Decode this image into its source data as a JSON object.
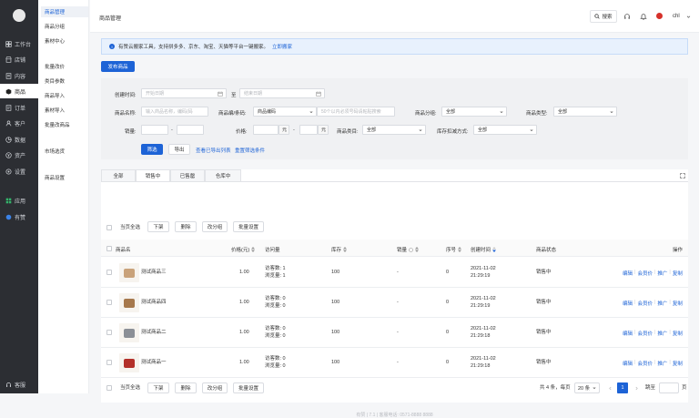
{
  "left_nav": {
    "items": [
      {
        "label": "工作台",
        "icon": "dashboard-icon"
      },
      {
        "label": "店铺",
        "icon": "store-icon"
      },
      {
        "label": "内容",
        "icon": "content-icon"
      },
      {
        "label": "商品",
        "icon": "goods-icon"
      },
      {
        "label": "订单",
        "icon": "order-icon"
      },
      {
        "label": "客户",
        "icon": "customer-icon"
      },
      {
        "label": "数据",
        "icon": "data-icon"
      },
      {
        "label": "资产",
        "icon": "asset-icon"
      },
      {
        "label": "设置",
        "icon": "settings-icon"
      },
      {
        "label": "应用",
        "icon": "apps-icon"
      },
      {
        "label": "有赞",
        "icon": "youzan-icon"
      }
    ],
    "service": "客服"
  },
  "sub_nav": {
    "items": [
      "商品管理",
      "商品分组",
      "素材中心",
      "批量改价",
      "类目参数",
      "商品导入",
      "素材导入",
      "批量改商品",
      "市场选货",
      "商品设置"
    ]
  },
  "topbar": {
    "title": "商品管理",
    "search": "搜索",
    "user": "chl"
  },
  "notice": {
    "text": "有赞云搬家工具，支持拼多多、京东、淘宝、天猫等平台一键搬家。",
    "link": "立即搬家"
  },
  "publish_button": "发布商品",
  "filter": {
    "created_label": "创建时间:",
    "start_placeholder": "开始日期",
    "to": "至",
    "end_placeholder": "结束日期",
    "name_label": "商品名称:",
    "name_placeholder": "输入商品名称，编码(码",
    "code_label": "商品编/条码:",
    "code_value": "商品编码",
    "code_placeholder": "50个以内必须号码请粘贴搜索",
    "group_label": "商品分组:",
    "group_value": "全部",
    "type_label": "商品类型:",
    "type_value": "全部",
    "sales_label": "销量:",
    "dash": "-",
    "price_label": "价格:",
    "yuan": "元",
    "category_label": "商品类目:",
    "category_value": "全部",
    "stock_label": "库存扣减方式:",
    "stock_value": "全部",
    "filter_btn": "筛选",
    "export_btn": "导出",
    "view_exported": "查看已导出列表",
    "reset": "重置筛选条件"
  },
  "tabs": [
    "全部",
    "销售中",
    "已售罄",
    "仓库中"
  ],
  "bulk": {
    "select_all": "当页全选",
    "off_shelf": "下架",
    "delete": "删除",
    "change_group": "改分组",
    "batch_settings": "批量设置"
  },
  "table": {
    "headers": [
      "商品名",
      "价格(元)",
      "访问量",
      "库存",
      "销量",
      "序号",
      "创建时间",
      "商品状态",
      "操作"
    ],
    "rows": [
      {
        "name": "测试商品三",
        "price": "1.00",
        "visitors": "访客数: 1",
        "views": "浏览量: 1",
        "stock": "100",
        "sales": "-",
        "seq": "0",
        "date": "2021-11-02",
        "time": "21:29:19",
        "status": "销售中",
        "thumb": "#c9a27a"
      },
      {
        "name": "测试商品四",
        "price": "1.00",
        "visitors": "访客数: 0",
        "views": "浏览量: 0",
        "stock": "100",
        "sales": "-",
        "seq": "0",
        "date": "2021-11-02",
        "time": "21:29:19",
        "status": "销售中",
        "thumb": "#a6784c"
      },
      {
        "name": "测试商品二",
        "price": "1.00",
        "visitors": "访客数: 0",
        "views": "浏览量: 0",
        "stock": "100",
        "sales": "-",
        "seq": "0",
        "date": "2021-11-02",
        "time": "21:29:18",
        "status": "销售中",
        "thumb": "#8b8f96"
      },
      {
        "name": "测试商品一",
        "price": "1.00",
        "visitors": "访客数: 0",
        "views": "浏览量: 0",
        "stock": "100",
        "sales": "-",
        "seq": "0",
        "date": "2021-11-02",
        "time": "21:29:18",
        "status": "销售中",
        "thumb": "#b3302a"
      }
    ],
    "actions": [
      "编辑",
      "会员价",
      "推广",
      "复制"
    ]
  },
  "pager": {
    "summary": "共 4 条，每页",
    "page_size": "20 条",
    "current": "1",
    "jump": "跳至",
    "page_unit": "页"
  },
  "footer": "有赞 | 7.1 | 客服电话: 0571-8888 8888"
}
